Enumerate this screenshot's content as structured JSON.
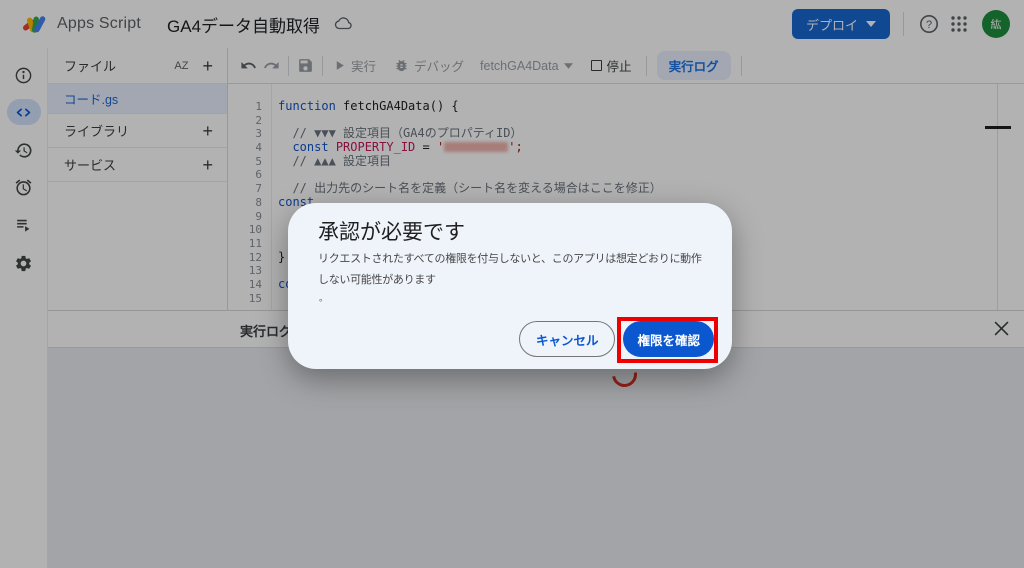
{
  "header": {
    "app_name": "Apps Script",
    "project_title": "GA4データ自動取得",
    "deploy_label": "デプロイ",
    "avatar_text": "紘",
    "icons": [
      "apps-script-logo",
      "cloud-saved-icon",
      "help-icon",
      "apps-grid-icon",
      "avatar"
    ]
  },
  "sidebar": {
    "items": [
      {
        "icon": "info-icon",
        "selected": false
      },
      {
        "icon": "code-editor-icon",
        "selected": true
      },
      {
        "icon": "history-icon",
        "selected": false
      },
      {
        "icon": "triggers-alarm-icon",
        "selected": false
      },
      {
        "icon": "executions-icon",
        "selected": false
      },
      {
        "icon": "settings-gear-icon",
        "selected": false
      }
    ]
  },
  "files_panel": {
    "title": "ファイル",
    "sort_icon": "AZ",
    "files": [
      {
        "name": "コード.gs",
        "selected": true
      }
    ],
    "sections": [
      {
        "label": "ライブラリ"
      },
      {
        "label": "サービス"
      }
    ]
  },
  "toolbar": {
    "run_label": "実行",
    "debug_label": "デバッグ",
    "function_selector": "fetchGA4Data",
    "stop_label": "停止",
    "log_label": "実行ログ"
  },
  "editor": {
    "lines": [
      [
        {
          "c": "kw",
          "t": "function"
        },
        {
          "c": "pl",
          "t": " "
        },
        {
          "c": "fn",
          "t": "fetchGA4Data"
        },
        {
          "c": "pl",
          "t": "() {"
        }
      ],
      [],
      [
        {
          "c": "cm",
          "t": "  // ▼▼▼ 設定項目（GA4のプロパティID）"
        }
      ],
      [
        {
          "c": "pl",
          "t": "  "
        },
        {
          "c": "kw",
          "t": "const"
        },
        {
          "c": "pl",
          "t": " "
        },
        {
          "c": "vr",
          "t": "PROPERTY_ID"
        },
        {
          "c": "pl",
          "t": " = "
        },
        {
          "c": "st",
          "t": "'"
        },
        {
          "c": "redact",
          "t": ""
        },
        {
          "c": "st",
          "t": "';"
        }
      ],
      [
        {
          "c": "cm",
          "t": "  // ▲▲▲ 設定項目"
        }
      ],
      [],
      [
        {
          "c": "cm",
          "t": "  // 出力先のシート名を定義（シート名を変える場合はここを修正）"
        }
      ],
      [
        {
          "c": "kw",
          "t": "const"
        }
      ],
      [],
      [],
      [],
      [
        {
          "c": "pl",
          "t": "}"
        }
      ],
      [],
      [
        {
          "c": "kw",
          "t": "const"
        }
      ],
      []
    ]
  },
  "log_panel": {
    "title": "実行ログ",
    "close_icon": "close-icon",
    "spinner_icon": "loading-spinner"
  },
  "dialog": {
    "title": "承認が必要です",
    "body": "リクエストされたすべての権限を付与しないと、このアプリは想定どおりに動作しない可能性があります",
    "body_period": "。",
    "cancel_label": "キャンセル",
    "confirm_label": "権限を確認"
  },
  "colors": {
    "primary_blue": "#0b57d0",
    "deploy_blue": "#1967d2",
    "annotation_red": "#ee0000",
    "avatar_green": "#1e8e3e",
    "selected_file_bg": "#e8f0fe"
  }
}
